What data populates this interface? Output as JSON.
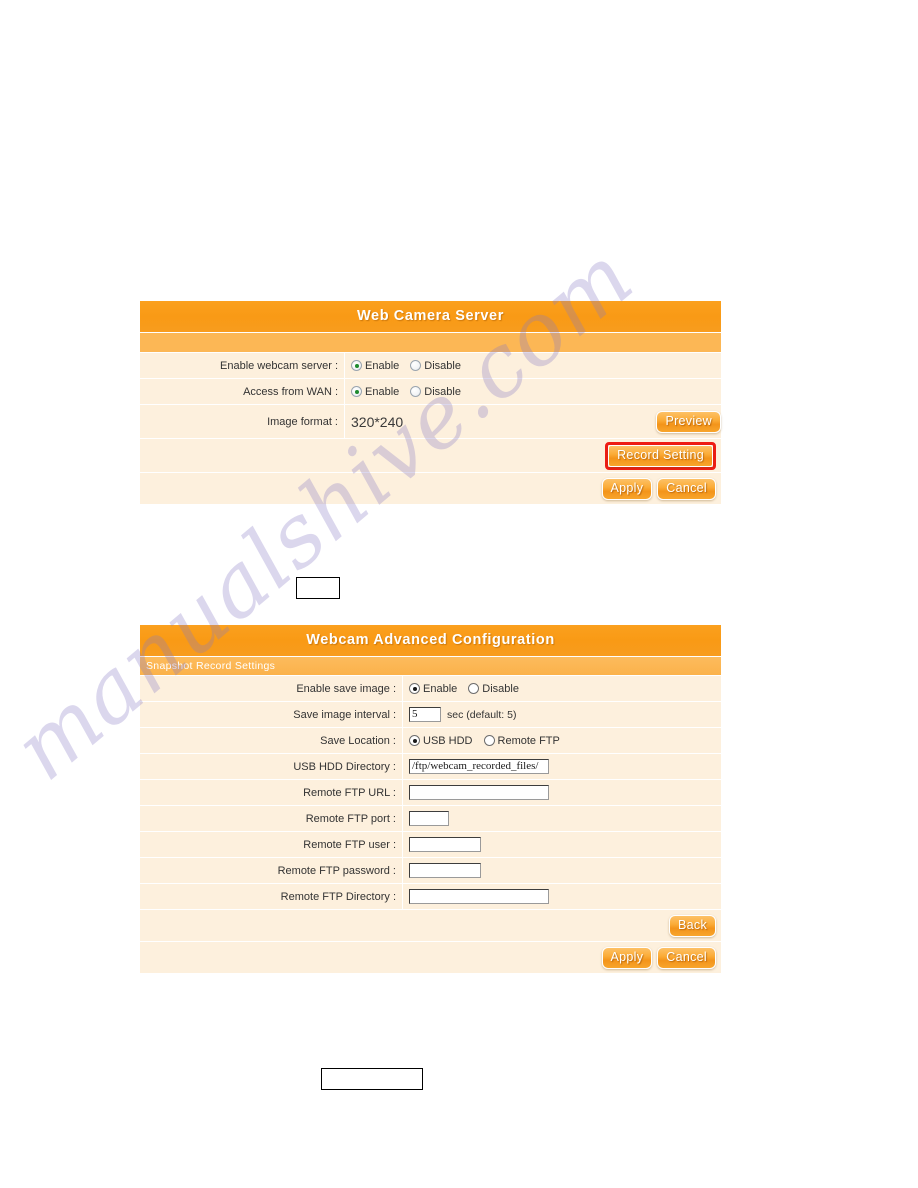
{
  "watermark": {
    "text": "manualshive.com"
  },
  "colors": {
    "header_orange": "#F89C1E",
    "subbar_orange": "#FCB755",
    "row_cream": "#FDF0DD",
    "button_orange": "#FBAB36",
    "highlight_red": "#EF1C14",
    "radio_green": "#1F8B2E"
  },
  "panel_webcam_server": {
    "title": "Web Camera Server",
    "rows": [
      {
        "label": "Enable webcam server :",
        "type": "radio",
        "options": [
          "Enable",
          "Disable"
        ],
        "selected": "Enable"
      },
      {
        "label": "Access from WAN :",
        "type": "radio",
        "options": [
          "Enable",
          "Disable"
        ],
        "selected": "Enable"
      },
      {
        "label": "Image format :",
        "type": "text-value",
        "value": "320*240",
        "button": "Preview"
      }
    ],
    "record_setting_button": "Record Setting",
    "record_setting_highlighted": true,
    "apply_label": "Apply",
    "cancel_label": "Cancel"
  },
  "panel_advanced_config": {
    "title": "Webcam Advanced Configuration",
    "section_label": "Snapshot Record Settings",
    "rows": [
      {
        "label": "Enable save image :",
        "type": "radio",
        "options": [
          "Enable",
          "Disable"
        ],
        "selected": "Enable"
      },
      {
        "label": "Save image interval :",
        "type": "input",
        "value": "5",
        "suffix": "sec (default: 5)"
      },
      {
        "label": "Save Location :",
        "type": "radio",
        "options": [
          "USB HDD",
          "Remote FTP"
        ],
        "selected": "USB HDD"
      },
      {
        "label": "USB HDD Directory :",
        "type": "input",
        "value": "/ftp/webcam_recorded_files/"
      },
      {
        "label": "Remote FTP URL :",
        "type": "input",
        "value": ""
      },
      {
        "label": "Remote FTP port :",
        "type": "input",
        "value": ""
      },
      {
        "label": "Remote FTP user :",
        "type": "input",
        "value": ""
      },
      {
        "label": "Remote FTP password :",
        "type": "input",
        "value": ""
      },
      {
        "label": "Remote FTP Directory :",
        "type": "input",
        "value": ""
      }
    ],
    "back_label": "Back",
    "apply_label": "Apply",
    "cancel_label": "Cancel"
  }
}
